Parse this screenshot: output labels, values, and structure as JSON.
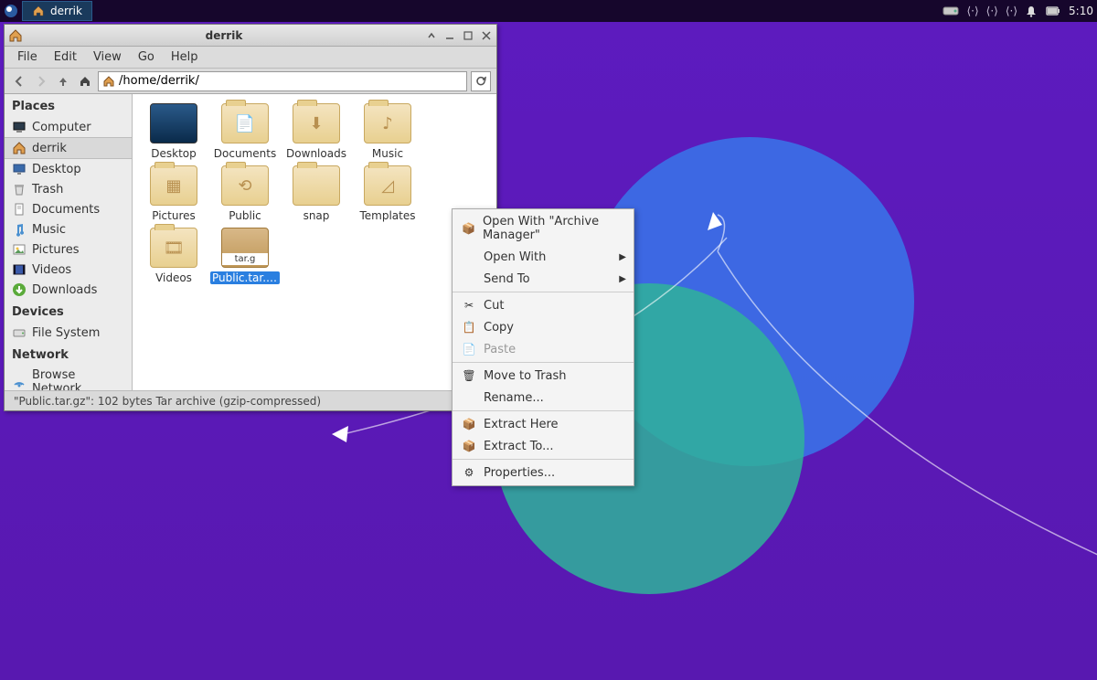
{
  "taskbar": {
    "active_task": "derrik",
    "clock": "5:10"
  },
  "window": {
    "title": "derrik",
    "menus": [
      "File",
      "Edit",
      "View",
      "Go",
      "Help"
    ],
    "path": "/home/derrik/",
    "statusbar": "\"Public.tar.gz\": 102 bytes Tar archive (gzip-compressed)"
  },
  "sidebar": {
    "sections": [
      {
        "title": "Places",
        "items": [
          {
            "icon": "computer",
            "label": "Computer"
          },
          {
            "icon": "home",
            "label": "derrik",
            "selected": true
          },
          {
            "icon": "desktop",
            "label": "Desktop"
          },
          {
            "icon": "trash",
            "label": "Trash"
          },
          {
            "icon": "documents",
            "label": "Documents"
          },
          {
            "icon": "music",
            "label": "Music"
          },
          {
            "icon": "pictures",
            "label": "Pictures"
          },
          {
            "icon": "videos",
            "label": "Videos"
          },
          {
            "icon": "downloads",
            "label": "Downloads"
          }
        ]
      },
      {
        "title": "Devices",
        "items": [
          {
            "icon": "drive",
            "label": "File System"
          }
        ]
      },
      {
        "title": "Network",
        "items": [
          {
            "icon": "network",
            "label": "Browse Network"
          }
        ]
      }
    ]
  },
  "files": [
    {
      "label": "Desktop",
      "type": "desktop"
    },
    {
      "label": "Documents",
      "type": "folder",
      "sym": "📄"
    },
    {
      "label": "Downloads",
      "type": "folder",
      "sym": "⬇"
    },
    {
      "label": "Music",
      "type": "folder",
      "sym": "♪"
    },
    {
      "label": "Pictures",
      "type": "folder",
      "sym": "▦"
    },
    {
      "label": "Public",
      "type": "folder",
      "sym": "⟲"
    },
    {
      "label": "snap",
      "type": "folder",
      "sym": ""
    },
    {
      "label": "Templates",
      "type": "folder",
      "sym": "◿"
    },
    {
      "label": "Videos",
      "type": "folder",
      "sym": "🎞"
    },
    {
      "label": "Public.tar.gz",
      "type": "archive",
      "selected": true
    }
  ],
  "context_menu": [
    {
      "icon": "📦",
      "label": "Open With \"Archive Manager\""
    },
    {
      "icon": "",
      "label": "Open With",
      "submenu": true
    },
    {
      "icon": "",
      "label": "Send To",
      "submenu": true
    },
    {
      "sep": true
    },
    {
      "icon": "✂",
      "label": "Cut"
    },
    {
      "icon": "📋",
      "label": "Copy"
    },
    {
      "icon": "📄",
      "label": "Paste",
      "disabled": true
    },
    {
      "sep": true
    },
    {
      "icon": "🗑",
      "label": "Move to Trash"
    },
    {
      "icon": "",
      "label": "Rename..."
    },
    {
      "sep": true
    },
    {
      "icon": "📦",
      "label": "Extract Here"
    },
    {
      "icon": "📦",
      "label": "Extract To..."
    },
    {
      "sep": true
    },
    {
      "icon": "⚙",
      "label": "Properties..."
    }
  ]
}
